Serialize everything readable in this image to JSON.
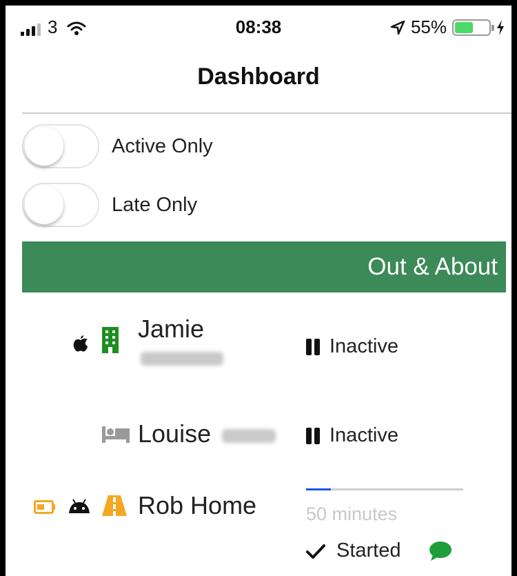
{
  "status_bar": {
    "carrier": "3",
    "time": "08:38",
    "battery_percent": "55%",
    "battery_level": 0.55,
    "icons": [
      "signal-icon",
      "wifi-icon",
      "location-arrow-icon",
      "battery-icon",
      "charging-bolt-icon"
    ]
  },
  "nav": {
    "title": "Dashboard"
  },
  "filters": [
    {
      "label": "Active Only",
      "on": false
    },
    {
      "label": "Late Only",
      "on": false
    }
  ],
  "section": {
    "title": "Out & About",
    "color": "#3b8a57"
  },
  "people": [
    {
      "first_name": "Jamie",
      "icons": [
        "apple-icon",
        "building-icon"
      ],
      "status": "Inactive",
      "status_icon": "pause-icon"
    },
    {
      "first_name": "Louise",
      "icons": [
        "bed-icon"
      ],
      "status": "Inactive",
      "status_icon": "pause-icon"
    },
    {
      "name": "Rob Home",
      "icons": [
        "battery-low-icon",
        "android-icon",
        "road-icon"
      ],
      "progress": 0.16,
      "duration": "50 minutes",
      "status": "Started",
      "status_icon": "check-icon",
      "has_message": true
    }
  ],
  "colors": {
    "green": "#3b8a57",
    "building_green": "#1e8e1e",
    "orange": "#f5a623",
    "progress_blue": "#1a55e8",
    "chat_green": "#1f9e3a"
  }
}
